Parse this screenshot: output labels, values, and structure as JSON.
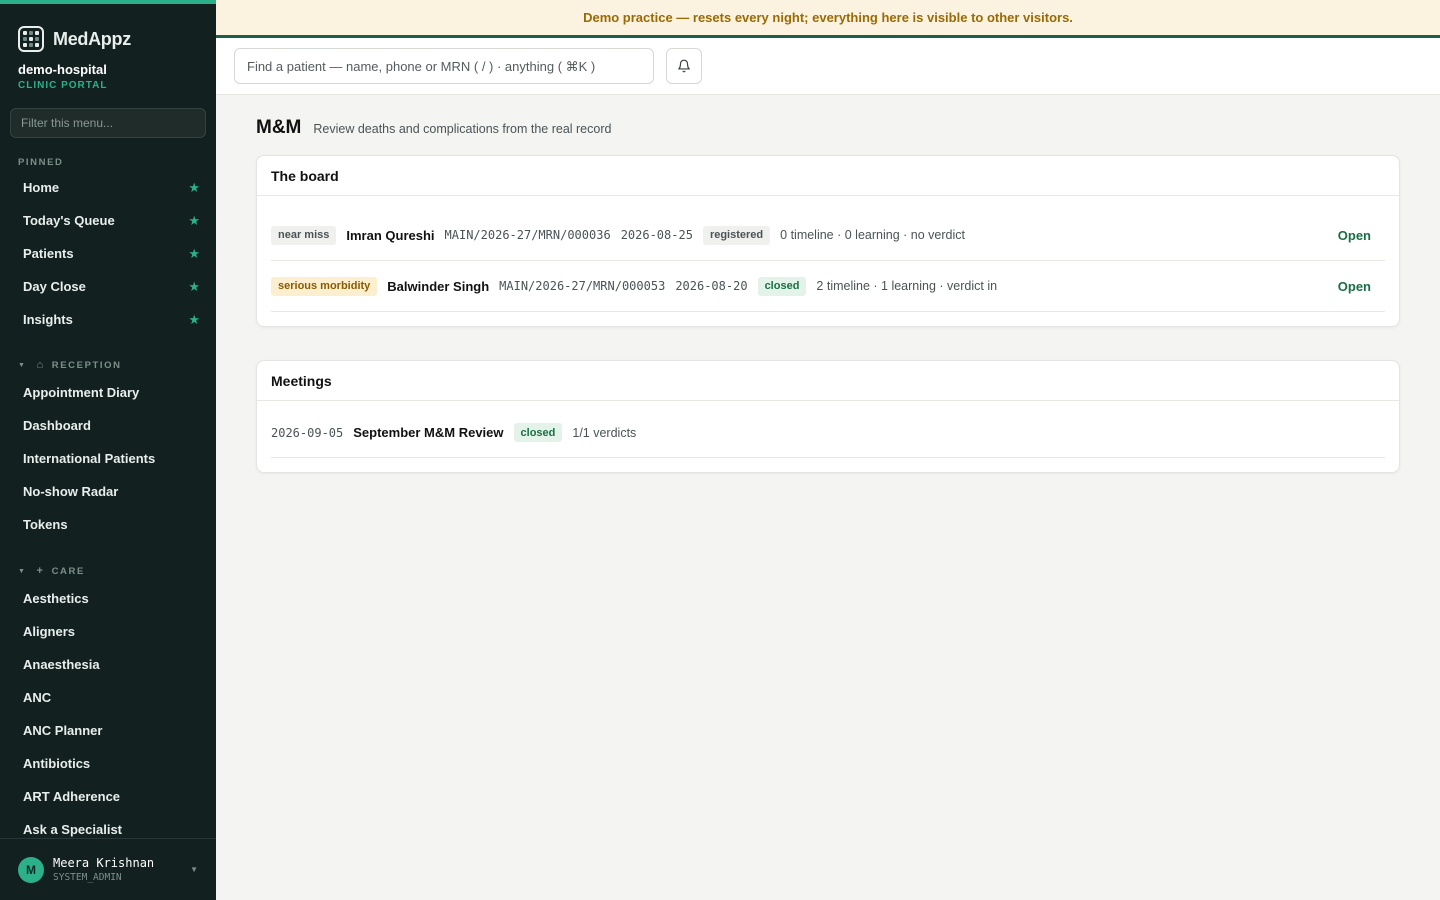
{
  "app": {
    "name": "MedAppz"
  },
  "org": {
    "name": "demo-hospital",
    "portal": "CLINIC PORTAL"
  },
  "sidebar": {
    "filter_placeholder": "Filter this menu...",
    "pinned_label": "PINNED",
    "pinned": [
      {
        "label": "Home"
      },
      {
        "label": "Today's Queue"
      },
      {
        "label": "Patients"
      },
      {
        "label": "Day Close"
      },
      {
        "label": "Insights"
      }
    ],
    "reception_label": "RECEPTION",
    "reception": [
      {
        "label": "Appointment Diary"
      },
      {
        "label": "Dashboard"
      },
      {
        "label": "International Patients"
      },
      {
        "label": "No-show Radar"
      },
      {
        "label": "Tokens"
      }
    ],
    "care_label": "CARE",
    "care": [
      {
        "label": "Aesthetics"
      },
      {
        "label": "Aligners"
      },
      {
        "label": "Anaesthesia"
      },
      {
        "label": "ANC"
      },
      {
        "label": "ANC Planner"
      },
      {
        "label": "Antibiotics"
      },
      {
        "label": "ART Adherence"
      },
      {
        "label": "Ask a Specialist"
      }
    ]
  },
  "user": {
    "initial": "M",
    "name": "Meera Krishnan",
    "role": "SYSTEM_ADMIN"
  },
  "banner": {
    "text": "Demo practice — resets every night; everything here is visible to other visitors."
  },
  "search": {
    "placeholder": "Find a patient — name, phone or MRN ( / ) · anything ( ⌘K )"
  },
  "page": {
    "title": "M&M",
    "subtitle": "Review deaths and complications from the real record"
  },
  "board": {
    "title": "The board",
    "open_label": "Open",
    "rows": [
      {
        "severity": "near miss",
        "patient": "Imran Qureshi",
        "mrn": "MAIN/2026-27/MRN/000036",
        "date": "2026-08-25",
        "status": "registered",
        "summary": "0 timeline · 0 learning · no verdict"
      },
      {
        "severity": "serious morbidity",
        "patient": "Balwinder Singh",
        "mrn": "MAIN/2026-27/MRN/000053",
        "date": "2026-08-20",
        "status": "closed",
        "summary": "2 timeline · 1 learning · verdict in"
      }
    ]
  },
  "meetings": {
    "title": "Meetings",
    "rows": [
      {
        "date": "2026-09-05",
        "name": "September M&M Review",
        "status": "closed",
        "verdicts": "1/1 verdicts"
      }
    ]
  },
  "colors": {
    "accent": "#2bb08a",
    "sidebar_bg": "#12201f",
    "banner_bg": "#fbf3e0",
    "banner_text": "#9a6a04",
    "link": "#1a6e45"
  }
}
